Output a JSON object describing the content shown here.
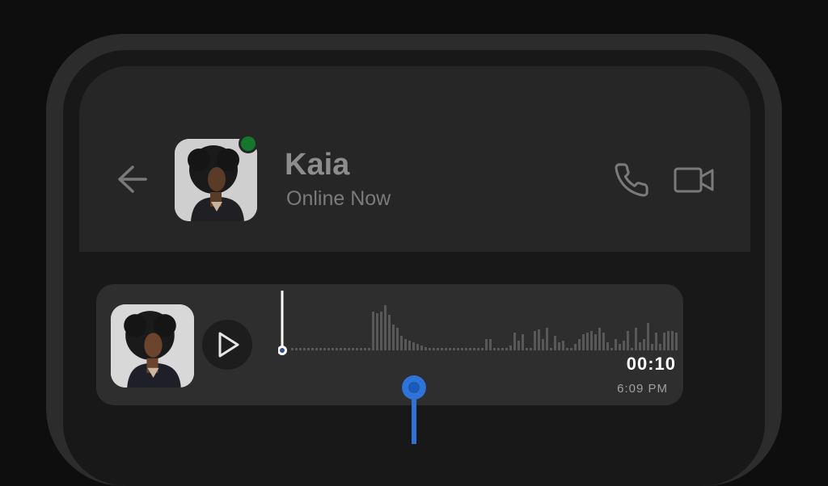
{
  "contact": {
    "name": "Kaia",
    "status": "Online Now",
    "online": true
  },
  "header": {
    "back_icon": "arrow-left-icon",
    "call_icon": "phone-icon",
    "video_icon": "video-camera-icon"
  },
  "voice_message": {
    "duration": "00:10",
    "time": "6:09 PM",
    "play_icon": "play-icon",
    "progress": 0
  },
  "colors": {
    "online_dot": "#15772b",
    "pointer": "#2f72d8",
    "waveform": "#585858"
  }
}
